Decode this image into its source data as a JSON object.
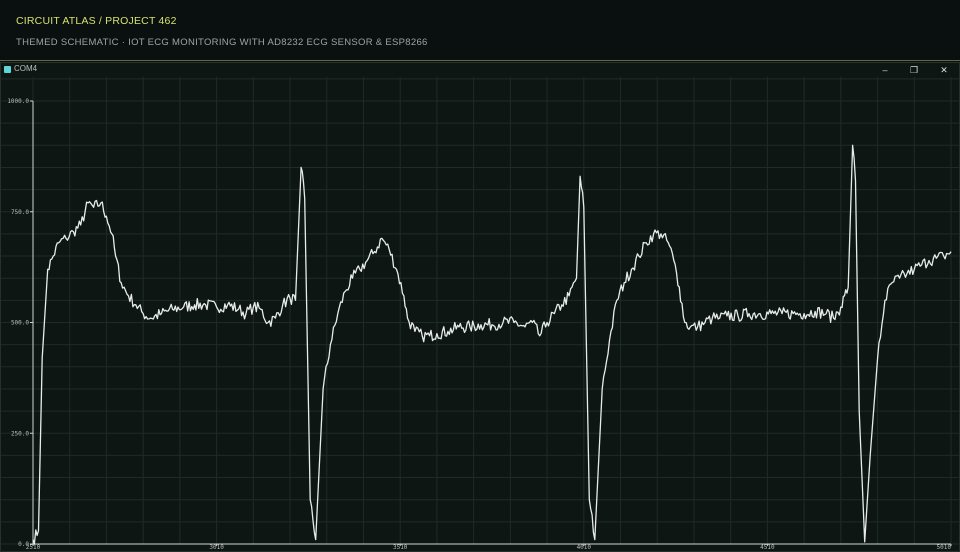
{
  "header": {
    "title": "CIRCUIT ATLAS / PROJECT 462",
    "subtitle": "THEMED SCHEMATIC · IOT ECG MONITORING WITH AD8232 ECG SENSOR & ESP8266"
  },
  "window": {
    "title": "COM4",
    "minimize_glyph": "‒",
    "restore_glyph": "❐",
    "close_glyph": "✕"
  },
  "colors": {
    "accent": "#d6e06a",
    "trace": "#e8ece9",
    "grid": "#1f2b28",
    "background": "#0e1614",
    "status": "#5fd6d6"
  },
  "chart_data": {
    "type": "line",
    "grid": true,
    "ylim": [
      0,
      1000
    ],
    "xlim": [
      0,
      2500
    ],
    "y_ticks": [
      {
        "value": 1000,
        "label": "1000.0"
      },
      {
        "value": 750,
        "label": "750.0"
      },
      {
        "value": 500,
        "label": "500.0"
      },
      {
        "value": 250,
        "label": "250.0"
      },
      {
        "value": 0,
        "label": "0.0"
      }
    ],
    "x_ticks": [
      {
        "value": 0,
        "label": "2510"
      },
      {
        "value": 500,
        "label": "3010"
      },
      {
        "value": 1000,
        "label": "3510"
      },
      {
        "value": 1500,
        "label": "4010"
      },
      {
        "value": 2000,
        "label": "4510"
      },
      {
        "value": 2500,
        "label": "5010"
      }
    ],
    "series": [
      {
        "values": [
          [
            0,
            10
          ],
          [
            15,
            30
          ],
          [
            25,
            420
          ],
          [
            40,
            620
          ],
          [
            55,
            650
          ],
          [
            70,
            680
          ],
          [
            90,
            690
          ],
          [
            110,
            705
          ],
          [
            130,
            720
          ],
          [
            150,
            770
          ],
          [
            165,
            760
          ],
          [
            185,
            770
          ],
          [
            200,
            740
          ],
          [
            215,
            700
          ],
          [
            225,
            650
          ],
          [
            240,
            590
          ],
          [
            260,
            560
          ],
          [
            280,
            540
          ],
          [
            300,
            520
          ],
          [
            320,
            510
          ],
          [
            350,
            520
          ],
          [
            380,
            530
          ],
          [
            410,
            535
          ],
          [
            440,
            540
          ],
          [
            470,
            540
          ],
          [
            500,
            535
          ],
          [
            530,
            540
          ],
          [
            560,
            530
          ],
          [
            580,
            520
          ],
          [
            600,
            535
          ],
          [
            620,
            530
          ],
          [
            640,
            500
          ],
          [
            660,
            510
          ],
          [
            680,
            540
          ],
          [
            700,
            555
          ],
          [
            715,
            550
          ],
          [
            730,
            850
          ],
          [
            740,
            780
          ],
          [
            755,
            100
          ],
          [
            770,
            10
          ],
          [
            790,
            350
          ],
          [
            810,
            450
          ],
          [
            830,
            520
          ],
          [
            850,
            570
          ],
          [
            870,
            600
          ],
          [
            890,
            620
          ],
          [
            910,
            640
          ],
          [
            930,
            660
          ],
          [
            950,
            690
          ],
          [
            970,
            665
          ],
          [
            990,
            620
          ],
          [
            1010,
            560
          ],
          [
            1020,
            510
          ],
          [
            1040,
            480
          ],
          [
            1060,
            470
          ],
          [
            1080,
            470
          ],
          [
            1100,
            475
          ],
          [
            1130,
            480
          ],
          [
            1160,
            490
          ],
          [
            1190,
            490
          ],
          [
            1220,
            495
          ],
          [
            1250,
            495
          ],
          [
            1280,
            500
          ],
          [
            1310,
            500
          ],
          [
            1340,
            490
          ],
          [
            1360,
            500
          ],
          [
            1380,
            470
          ],
          [
            1400,
            500
          ],
          [
            1420,
            520
          ],
          [
            1440,
            540
          ],
          [
            1460,
            560
          ],
          [
            1480,
            600
          ],
          [
            1490,
            830
          ],
          [
            1500,
            760
          ],
          [
            1515,
            100
          ],
          [
            1530,
            10
          ],
          [
            1550,
            350
          ],
          [
            1570,
            460
          ],
          [
            1590,
            550
          ],
          [
            1610,
            590
          ],
          [
            1630,
            620
          ],
          [
            1650,
            650
          ],
          [
            1670,
            680
          ],
          [
            1690,
            700
          ],
          [
            1710,
            700
          ],
          [
            1730,
            680
          ],
          [
            1745,
            640
          ],
          [
            1760,
            580
          ],
          [
            1775,
            500
          ],
          [
            1790,
            490
          ],
          [
            1810,
            490
          ],
          [
            1830,
            500
          ],
          [
            1850,
            510
          ],
          [
            1870,
            510
          ],
          [
            1890,
            515
          ],
          [
            1920,
            515
          ],
          [
            1950,
            520
          ],
          [
            1980,
            520
          ],
          [
            2010,
            520
          ],
          [
            2040,
            520
          ],
          [
            2070,
            520
          ],
          [
            2100,
            520
          ],
          [
            2130,
            525
          ],
          [
            2160,
            520
          ],
          [
            2180,
            510
          ],
          [
            2200,
            535
          ],
          [
            2210,
            560
          ],
          [
            2220,
            580
          ],
          [
            2232,
            900
          ],
          [
            2240,
            820
          ],
          [
            2250,
            300
          ],
          [
            2265,
            5
          ],
          [
            2280,
            200
          ],
          [
            2300,
            420
          ],
          [
            2320,
            550
          ],
          [
            2340,
            590
          ],
          [
            2360,
            600
          ],
          [
            2380,
            610
          ],
          [
            2400,
            620
          ],
          [
            2420,
            630
          ],
          [
            2440,
            640
          ],
          [
            2460,
            645
          ],
          [
            2480,
            650
          ],
          [
            2500,
            660
          ]
        ]
      }
    ]
  }
}
